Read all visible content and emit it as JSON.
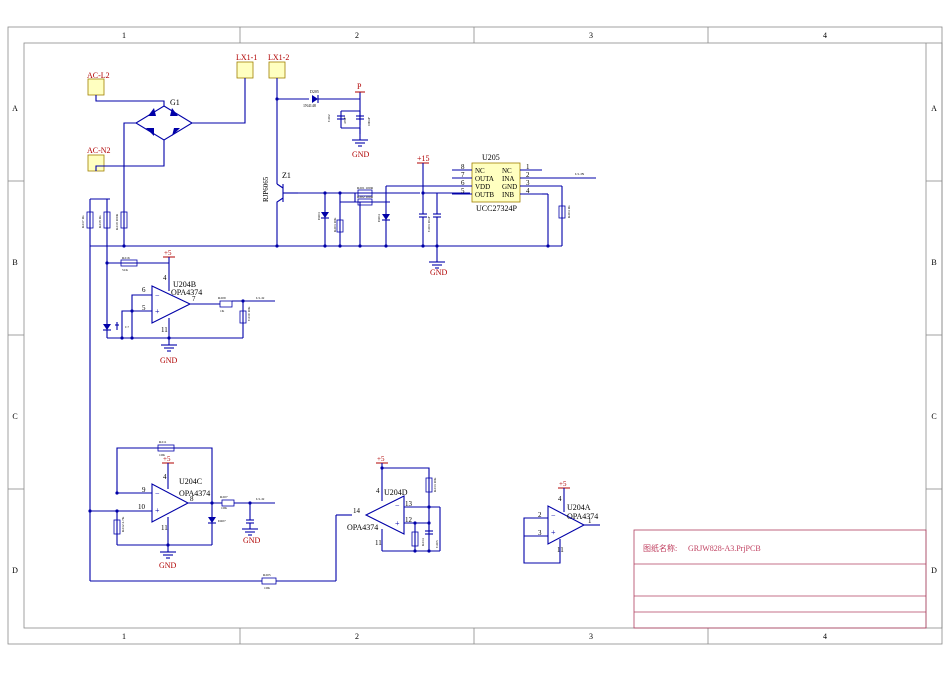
{
  "frame": {
    "column_labels": [
      "1",
      "2",
      "3",
      "4"
    ],
    "row_labels": [
      "A",
      "B",
      "C",
      "D"
    ]
  },
  "connectors": {
    "ac_l2": "AC-L2",
    "ac_n2": "AC-N2",
    "lx1_1": "LX1-1",
    "lx1_2": "LX1-2"
  },
  "parts": {
    "bridge": "G1",
    "transistor_ref": "Z1",
    "transistor_part": "RJP6065",
    "driver_ref": "U205",
    "driver_part": "UCC27324P",
    "diode_upper": "D205",
    "opamp_b_ref": "U204B",
    "opamp_c_ref": "U204C",
    "opamp_d_ref": "U204D",
    "opamp_a_ref": "U204A",
    "opamp_part": "OPA4374"
  },
  "driver_pins": {
    "left": [
      {
        "num": "8",
        "name": "NC"
      },
      {
        "num": "7",
        "name": "OUTA"
      },
      {
        "num": "6",
        "name": "VDD"
      },
      {
        "num": "5",
        "name": "OUTB"
      }
    ],
    "right": [
      {
        "num": "1",
        "name": "NC"
      },
      {
        "num": "2",
        "name": "INA"
      },
      {
        "num": "3",
        "name": "GND"
      },
      {
        "num": "4",
        "name": "INB"
      }
    ]
  },
  "opamp_pins": {
    "b": {
      "vplus": "4",
      "vminus": "11",
      "in_a": "6",
      "in_b": "5",
      "out": "7"
    },
    "c": {
      "vplus": "4",
      "vminus": "11",
      "in_a": "9",
      "in_b": "10",
      "out": "8"
    },
    "d": {
      "vplus": "4",
      "vminus": "11",
      "in_a": "13",
      "in_b": "12",
      "out": "14"
    },
    "a": {
      "vplus": "4",
      "vminus": "11",
      "in_a": "2",
      "in_b": "3",
      "out": "1"
    }
  },
  "rails": {
    "p": "P",
    "plus15": "+15",
    "plus5": "+5",
    "gnd": "GND"
  },
  "title_block": {
    "drawing_name_label": "图纸名称:",
    "drawing_name_value": "GRJW828-A3.PrjPCB"
  },
  "colors": {
    "wire": "#0000a8",
    "label": "#b00000",
    "connector_fill": "#ffffc0",
    "frame": "#8a8a8a",
    "title_text": "#c04060"
  }
}
